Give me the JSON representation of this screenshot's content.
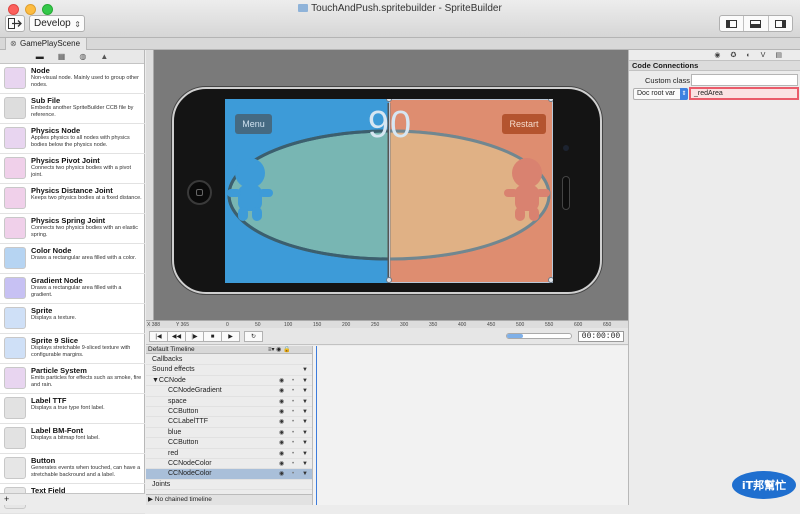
{
  "window": {
    "title": "TouchAndPush.spritebuilder - SpriteBuilder"
  },
  "toolbar": {
    "publish_icon": "publish-arrow-icon",
    "target_select": "Develop",
    "view_toggle_icons": [
      "left-panel-icon",
      "bottom-panel-icon",
      "right-panel-icon"
    ]
  },
  "doc_tab": {
    "label": "GamePlayScene"
  },
  "library": {
    "tabs": [
      "folder-icon",
      "grid-icon",
      "box-icon",
      "warning-icon"
    ],
    "items": [
      {
        "name": "Node",
        "desc": "Non-visual node. Mainly used to group other nodes."
      },
      {
        "name": "Sub File",
        "desc": "Embeds another SpriteBuilder CCB file by reference."
      },
      {
        "name": "Physics Node",
        "desc": "Applies physics to all nodes with physics bodies below the physics node."
      },
      {
        "name": "Physics Pivot Joint",
        "desc": "Connects two physics bodies with a pivot joint."
      },
      {
        "name": "Physics Distance Joint",
        "desc": "Keeps two physics bodies at a fixed distance."
      },
      {
        "name": "Physics Spring Joint",
        "desc": "Connects two physics bodies with an elastic spring."
      },
      {
        "name": "Color Node",
        "desc": "Draws a rectangular area filled with a color."
      },
      {
        "name": "Gradient Node",
        "desc": "Draws a rectangular area filled with a gradient."
      },
      {
        "name": "Sprite",
        "desc": "Displays a texture."
      },
      {
        "name": "Sprite 9 Slice",
        "desc": "Displays stretchable 9-sliced texture with configurable margins."
      },
      {
        "name": "Particle System",
        "desc": "Emits particles for effects such as smoke, fire and rain."
      },
      {
        "name": "Label TTF",
        "desc": "Displays a true type font label."
      },
      {
        "name": "Label BM-Font",
        "desc": "Displays a bitmap font label."
      },
      {
        "name": "Button",
        "desc": "Generates events when touched, can have a stretchable backround and a label."
      },
      {
        "name": "Text Field",
        "desc": ""
      }
    ],
    "add_button": "+"
  },
  "stage": {
    "menu_label": "Menu",
    "restart_label": "Restart",
    "score": "90",
    "ruler_readout_x": "X 388",
    "ruler_readout_y": "Y 365",
    "ruler_ticks": [
      "0",
      "50",
      "100",
      "150",
      "200",
      "250",
      "300",
      "350",
      "400",
      "450",
      "500",
      "550",
      "600",
      "650"
    ]
  },
  "inspector": {
    "tabs": [
      "eye-icon",
      "gear-icon",
      "code-icon",
      "branch-icon",
      "template-icon"
    ],
    "section_title": "Code Connections",
    "custom_class_label": "Custom class",
    "custom_class_value": "",
    "doc_root_var_label": "Doc root var",
    "doc_root_var_value": "_redArea"
  },
  "timeline": {
    "timecode": "00:00:00",
    "timeline_name": "Default Timeline",
    "chained_timeline": "No chained timeline",
    "rows": [
      {
        "label": "Callbacks",
        "indent": 0,
        "eye": false,
        "arrow": false
      },
      {
        "label": "Sound effects",
        "indent": 0,
        "eye": false,
        "arrow": true
      },
      {
        "label": "▼CCNode",
        "indent": 0,
        "eye": true,
        "arrow": true
      },
      {
        "label": "CCNodeGradient",
        "indent": 2,
        "eye": true,
        "arrow": true
      },
      {
        "label": "space",
        "indent": 2,
        "eye": true,
        "arrow": true
      },
      {
        "label": "CCButton",
        "indent": 2,
        "eye": true,
        "arrow": true
      },
      {
        "label": "CCLabelTTF",
        "indent": 2,
        "eye": true,
        "arrow": true
      },
      {
        "label": "blue",
        "indent": 2,
        "eye": true,
        "arrow": true
      },
      {
        "label": "CCButton",
        "indent": 2,
        "eye": true,
        "arrow": true
      },
      {
        "label": "red",
        "indent": 2,
        "eye": true,
        "arrow": true
      },
      {
        "label": "CCNodeColor",
        "indent": 2,
        "eye": true,
        "arrow": true
      },
      {
        "label": "CCNodeColor",
        "indent": 2,
        "eye": true,
        "arrow": true,
        "selected": true
      },
      {
        "label": "Joints",
        "indent": 0,
        "eye": false,
        "arrow": false
      }
    ]
  },
  "watermark": {
    "brand": "iT邦幫忙"
  },
  "colors": {
    "blue_half": "#3d9bd8",
    "red_half": "#ec6a3a",
    "highlight": "#ea5b6a",
    "selection": "#a9bfd9"
  }
}
